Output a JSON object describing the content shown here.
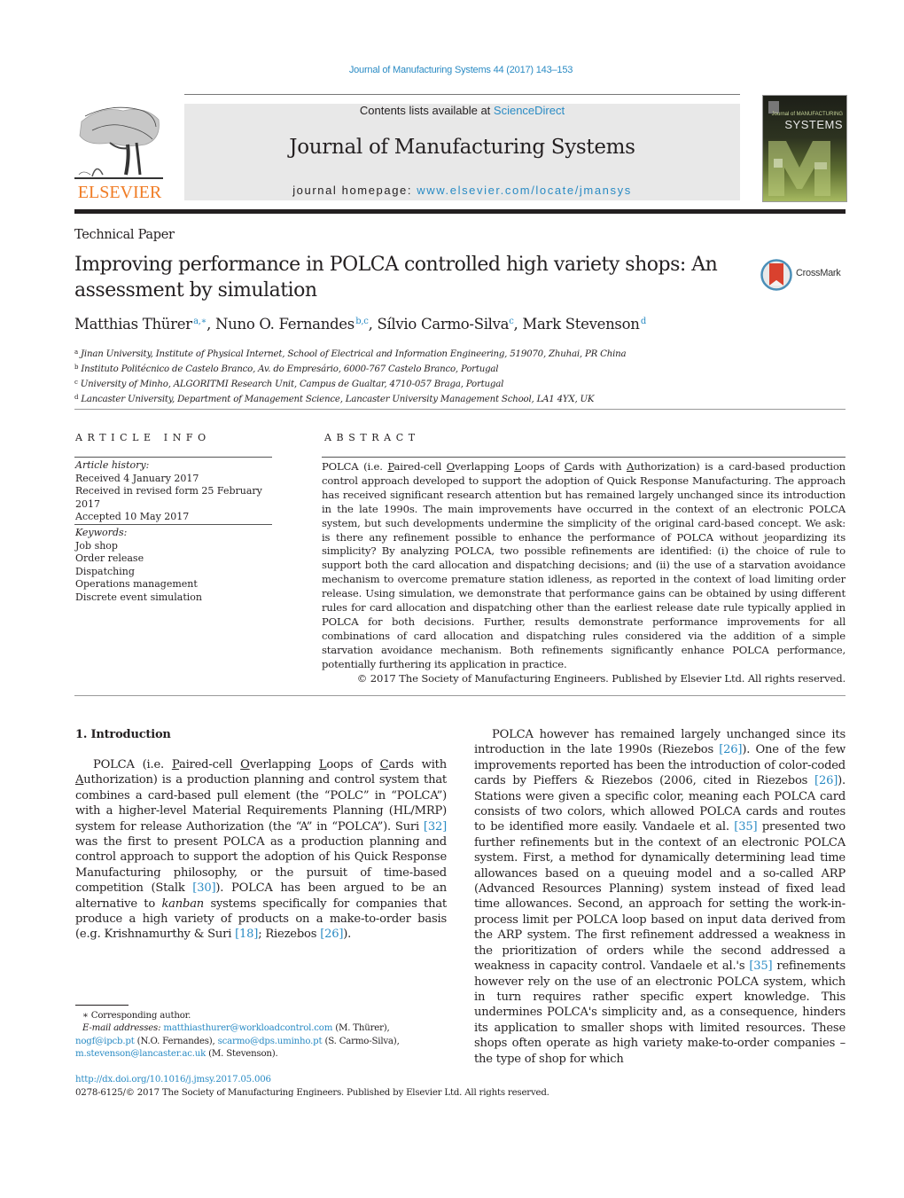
{
  "header": {
    "journal_reference": "Journal of Manufacturing Systems 44 (2017) 143–153",
    "contents_prefix": "Contents lists available at ",
    "contents_link": "ScienceDirect",
    "journal_title": "Journal of Manufacturing Systems",
    "homepage_prefix": "journal homepage: ",
    "homepage_link": "www.elsevier.com/locate/jmansys",
    "publisher_logo_text": "ELSEVIER",
    "cover": {
      "title_small": "Journal of MANUFACTURING",
      "title_big": "SYSTEMS",
      "badge": "sme"
    },
    "colors": {
      "link": "#2a8bc4",
      "elsevier_orange": "#f07c25",
      "banner_bg": "#e8e8e8"
    }
  },
  "article": {
    "type": "Technical Paper",
    "title": "Improving performance in POLCA controlled high variety shops: An assessment by simulation",
    "crossmark_label": "CrossMark",
    "authors": [
      {
        "name": "Matthias Thürer",
        "sup": "a,∗",
        "sep": ", "
      },
      {
        "name": "Nuno O. Fernandes",
        "sup": "b,c",
        "sep": ", "
      },
      {
        "name": "Sílvio Carmo-Silva",
        "sup": "c",
        "sep": ", "
      },
      {
        "name": "Mark Stevenson",
        "sup": "d",
        "sep": ""
      }
    ],
    "affiliations": [
      {
        "key": "a",
        "text": "Jinan University, Institute of Physical Internet, School of Electrical and Information Engineering, 519070, Zhuhai, PR China"
      },
      {
        "key": "b",
        "text": "Instituto Politécnico de Castelo Branco, Av. do Empresário, 6000-767 Castelo Branco, Portugal"
      },
      {
        "key": "c",
        "text": "University of Minho, ALGORITMI Research Unit, Campus de Gualtar, 4710-057 Braga, Portugal"
      },
      {
        "key": "d",
        "text": "Lancaster University, Department of Management Science, Lancaster University Management School, LA1 4YX, UK"
      }
    ]
  },
  "article_info": {
    "heading": "ARTICLE INFO",
    "history_label": "Article history:",
    "history": [
      "Received 4 January 2017",
      "Received in revised form 25 February 2017",
      "Accepted 10 May 2017"
    ],
    "keywords_label": "Keywords:",
    "keywords": [
      "Job shop",
      "Order release",
      "Dispatching",
      "Operations management",
      "Discrete event simulation"
    ]
  },
  "abstract": {
    "heading": "ABSTRACT",
    "p_start": "POLCA (i.e. ",
    "acronym": [
      {
        "u": "P",
        "rest": "aired-cell "
      },
      {
        "u": "O",
        "rest": "verlapping "
      },
      {
        "u": "L",
        "rest": "oops of "
      },
      {
        "u": "C",
        "rest": "ards with "
      },
      {
        "u": "A",
        "rest": "uthorization"
      }
    ],
    "p_rest": ") is a card-based production control approach developed to support the adoption of Quick Response Manufacturing. The approach has received significant research attention but has remained largely unchanged since its introduction in the late 1990s. The main improvements have occurred in the context of an electronic POLCA system, but such developments undermine the simplicity of the original card-based concept. We ask: is there any refinement possible to enhance the performance of POLCA without jeopardizing its simplicity? By analyzing POLCA, two possible refinements are identified: (i) the choice of rule to support both the card allocation and dispatching decisions; and (ii) the use of a starvation avoidance mechanism to overcome premature station idleness, as reported in the context of load limiting order release. Using simulation, we demonstrate that performance gains can be obtained by using different rules for card allocation and dispatching other than the earliest release date rule typically applied in POLCA for both decisions. Further, results demonstrate performance improvements for all combinations of card allocation and dispatching rules considered via the addition of a simple starvation avoidance mechanism. Both refinements significantly enhance POLCA performance, potentially furthering its application in practice.",
    "copyright": "© 2017 The Society of Manufacturing Engineers. Published by Elsevier Ltd. All rights reserved."
  },
  "body": {
    "intro_heading": "1.  Introduction",
    "left_col": {
      "s1": "POLCA (i.e. ",
      "acronym": [
        {
          "u": "P",
          "rest": "aired-cell "
        },
        {
          "u": "O",
          "rest": "verlapping "
        },
        {
          "u": "L",
          "rest": "oops of "
        },
        {
          "u": "C",
          "rest": "ards with "
        },
        {
          "u": "A",
          "rest": "uthorization"
        }
      ],
      "s2": ") is a production planning and control system that combines a card-based pull element (the “POLC” in “POLCA”) with a higher-level Material Requirements Planning (HL/MRP) system for release Authorization (the “A” in “POLCA”). Suri ",
      "c1": "[32]",
      "s3": " was the first to present POLCA as a production planning and control approach to support the adoption of his Quick Response Manufacturing philosophy, or the pursuit of time-based competition (Stalk ",
      "c2": "[30]",
      "s4": "). POLCA has been argued to be an alternative to ",
      "kanban": "kanban",
      "s5": " systems specifically for companies that produce a high variety of products on a make-to-order basis (e.g. Krishnamurthy & Suri ",
      "c3": "[18]",
      "s6": "; Riezebos ",
      "c4": "[26]",
      "s7": ")."
    },
    "right_col": {
      "s1": "POLCA however has remained largely unchanged since its introduction in the late 1990s (Riezebos ",
      "c1": "[26]",
      "s2": "). One of the few improvements reported has been the introduction of color-coded cards by Pieffers & Riezebos (2006, cited in Riezebos ",
      "c2": "[26]",
      "s3": "). Stations were given a specific color, meaning each POLCA card consists of two colors, which allowed POLCA cards and routes to be identified more easily. Vandaele et al. ",
      "c3": "[35]",
      "s4": " presented two further refinements but in the context of an electronic POLCA system. First, a method for dynamically determining lead time allowances based on a queuing model and a so-called ARP (Advanced Resources Planning) system instead of fixed lead time allowances. Second, an approach for setting the work-in-process limit per POLCA loop based on input data derived from the ARP system. The first refinement addressed a weakness in the prioritization of orders while the second addressed a weakness in capacity control. Vandaele et al.'s ",
      "c4": "[35]",
      "s5": " refinements however rely on the use of an electronic POLCA system, which in turn requires rather specific expert knowledge. This undermines POLCA's simplicity and, as a consequence, hinders its application to smaller shops with limited resources. These shops often operate as high variety make-to-order companies – the type of shop for which"
    }
  },
  "footnotes": {
    "corresponding": "∗  Corresponding author.",
    "emails_label": "E-mail addresses: ",
    "emails": [
      {
        "email": "matthiasthurer@workloadcontrol.com",
        "who": " (M. Thürer),"
      },
      {
        "email": "nogf@ipcb.pt",
        "who": " (N.O. Fernandes), "
      },
      {
        "email": "scarmo@dps.uminho.pt",
        "who": " (S. Carmo-Silva),"
      },
      {
        "email": "m.stevenson@lancaster.ac.uk",
        "who": " (M. Stevenson)."
      }
    ],
    "doi": "http://dx.doi.org/10.1016/j.jmsy.2017.05.006",
    "issn_line": "0278-6125/© 2017 The Society of Manufacturing Engineers. Published by Elsevier Ltd. All rights reserved."
  }
}
